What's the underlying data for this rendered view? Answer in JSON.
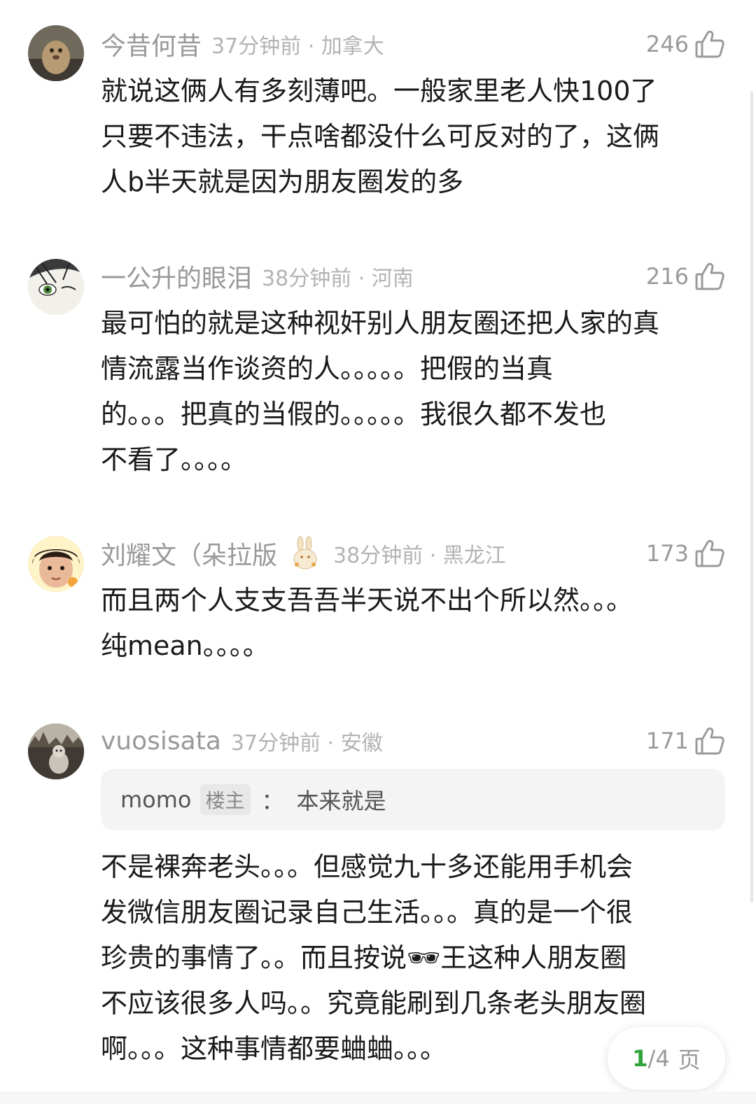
{
  "comments": [
    {
      "username": "今昔何昔",
      "time_location": "37分钟前 · 加拿大",
      "likes": "246",
      "text": "就说这俩人有多刻薄吧。一般家里老人快100了\n只要不违法，干点啥都没什么可反对的了，这俩\n人b半天就是因为朋友圈发的多"
    },
    {
      "username": "一公升的眼泪",
      "time_location": "38分钟前 · 河南",
      "likes": "216",
      "text": "最可怕的就是这种视奸别人朋友圈还把人家的真\n情流露当作谈资的人。。。。。把假的当真\n的。。。把真的当假的。。。。。我很久都不发也\n不看了。。。。"
    },
    {
      "username": "刘耀文（朵拉版",
      "time_location": "38分钟前 · 黑龙江",
      "likes": "173",
      "text": "而且两个人支支吾吾半天说不出个所以然。。。\n纯mean。。。。"
    },
    {
      "username": "vuosisata",
      "time_location": "37分钟前 · 安徽",
      "likes": "171",
      "quote": {
        "author": "momo",
        "badge": "楼主",
        "colon": "：",
        "text": "本来就是"
      },
      "text": "不是裸奔老头。。。但感觉九十多还能用手机会\n发微信朋友圈记录自己生活。。。真的是一个很\n珍贵的事情了。。而且按说🕶王这种人朋友圈\n不应该很多人吗。。究竟能刷到几条老头朋友圈\n啊。。。这种事情都要蛐蛐。。。"
    }
  ],
  "pagination": {
    "current": "1",
    "total": "/4",
    "unit": "页"
  },
  "icons": {
    "like": "thumbs-up-icon",
    "user_emoji": "rabbit-icon"
  },
  "colors": {
    "username": "#999999",
    "meta": "#b3b3b3",
    "body": "#1a1a1a",
    "page_current": "#2fa33b",
    "quote_bg": "#f4f4f4"
  }
}
